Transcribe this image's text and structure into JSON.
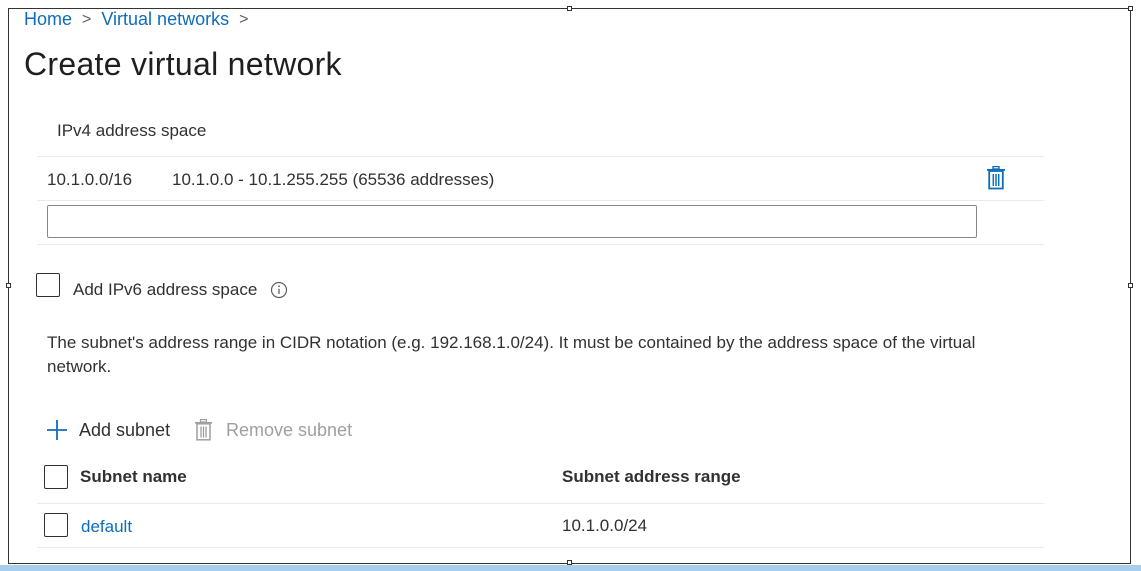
{
  "breadcrumb": {
    "home": "Home",
    "separator": ">",
    "virtual_networks": "Virtual networks"
  },
  "page": {
    "title": "Create virtual network"
  },
  "ipv4": {
    "section_label": "IPv4 address space",
    "entries": [
      {
        "cidr": "10.1.0.0/16",
        "range": "10.1.0.0 - 10.1.255.255 (65536 addresses)"
      }
    ],
    "new_address_value": "",
    "delete_icon": "trash-icon"
  },
  "ipv6": {
    "checkbox_label": "Add IPv6 address space",
    "checked": false,
    "info_icon": "info-icon"
  },
  "subnet_help_text": "The subnet's address range in CIDR notation (e.g. 192.168.1.0/24). It must be contained by the address space of the virtual network.",
  "toolbar": {
    "add_subnet": "Add subnet",
    "add_icon": "plus-icon",
    "remove_subnet": "Remove subnet",
    "remove_icon": "trash-icon",
    "remove_disabled": true
  },
  "subnet_table": {
    "columns": [
      "Subnet name",
      "Subnet address range"
    ],
    "rows": [
      {
        "name": "default",
        "range": "10.1.0.0/24"
      }
    ]
  },
  "colors": {
    "link": "#0f6cbd",
    "text": "#323130",
    "disabled": "#a19f9d",
    "divider": "#edebe9",
    "bottom_bar": "#a9cdec"
  }
}
